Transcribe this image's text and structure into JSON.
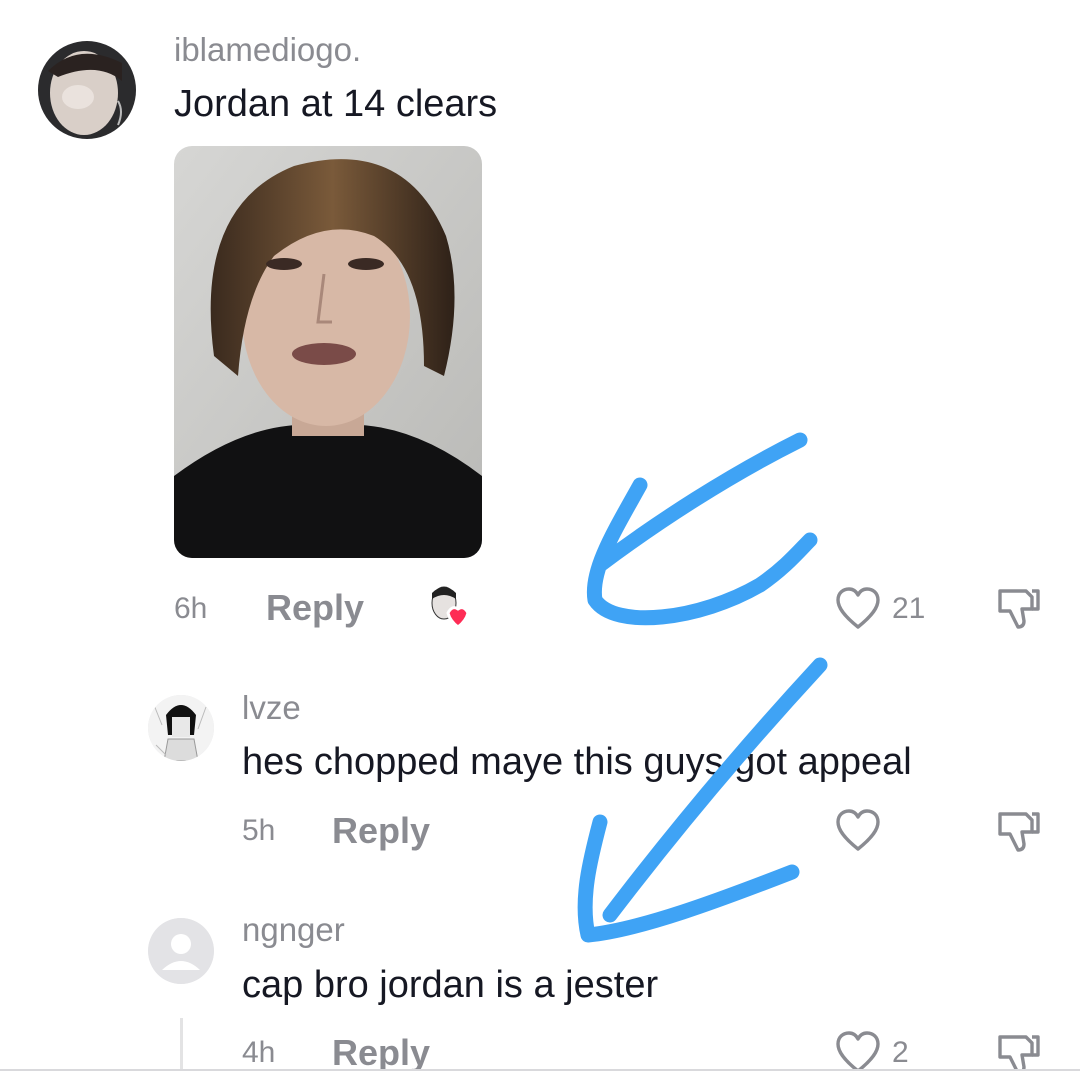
{
  "comments": [
    {
      "username": "iblamediogo.",
      "text": "Jordan at 14 clears",
      "time": "6h",
      "reply_label": "Reply",
      "likes": "21",
      "creator_liked": true
    },
    {
      "username": "lvze",
      "text": "hes chopped maye this guys got appeal",
      "time": "5h",
      "reply_label": "Reply",
      "likes": ""
    },
    {
      "username": "ngnger",
      "text": "cap bro jordan is a jester",
      "time": "4h",
      "reply_label": "Reply",
      "likes": "2"
    }
  ],
  "annotation_color": "#3fa3f5",
  "colors": {
    "text_primary": "#161823",
    "text_secondary": "#8a8b91",
    "heart_badge": "#fe2c55"
  }
}
